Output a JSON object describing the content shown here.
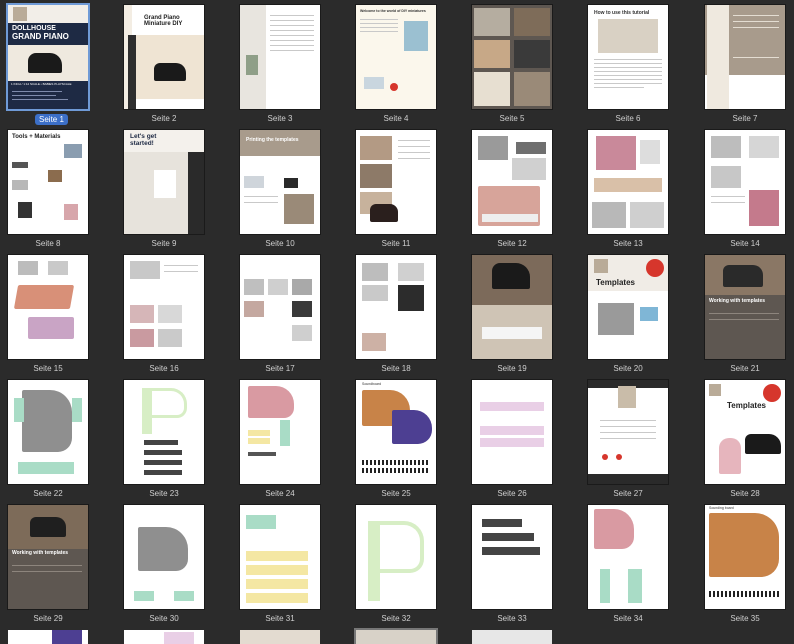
{
  "pages": [
    {
      "label": "Seite 1",
      "selected": true,
      "title_line1": "DOLLHOUSE",
      "title_line2": "GRAND PIANO",
      "subtitle": "1 INCH / 1:12 SCALE • BABIES PLAYSCALE"
    },
    {
      "label": "Seite 2",
      "title": "Grand Piano Miniature DIY"
    },
    {
      "label": "Seite 3"
    },
    {
      "label": "Seite 4",
      "title": "Welcome to the world of DIY miniatures"
    },
    {
      "label": "Seite 5"
    },
    {
      "label": "Seite 6",
      "title": "How to use this tutorial"
    },
    {
      "label": "Seite 7"
    },
    {
      "label": "Seite 8",
      "title": "Tools + Materials"
    },
    {
      "label": "Seite 9",
      "title": "Let's get started!"
    },
    {
      "label": "Seite 10",
      "title": "Printing the templates"
    },
    {
      "label": "Seite 11"
    },
    {
      "label": "Seite 12"
    },
    {
      "label": "Seite 13"
    },
    {
      "label": "Seite 14"
    },
    {
      "label": "Seite 15"
    },
    {
      "label": "Seite 16"
    },
    {
      "label": "Seite 17"
    },
    {
      "label": "Seite 18"
    },
    {
      "label": "Seite 19"
    },
    {
      "label": "Seite 20",
      "title": "Templates"
    },
    {
      "label": "Seite 21",
      "title": "Working with templates"
    },
    {
      "label": "Seite 22"
    },
    {
      "label": "Seite 23"
    },
    {
      "label": "Seite 24"
    },
    {
      "label": "Seite 25",
      "title": "Soundboard"
    },
    {
      "label": "Seite 26"
    },
    {
      "label": "Seite 27"
    },
    {
      "label": "Seite 28",
      "title": "Templates"
    },
    {
      "label": "Seite 29",
      "title": "Working with templates"
    },
    {
      "label": "Seite 30"
    },
    {
      "label": "Seite 31"
    },
    {
      "label": "Seite 32"
    },
    {
      "label": "Seite 33"
    },
    {
      "label": "Seite 34"
    },
    {
      "label": "Seite 35",
      "title": "Sounding board"
    }
  ],
  "colors": {
    "background": "#2b2b2b",
    "selection": "#3c6fc7",
    "navy": "#1e2a44",
    "taupe": "#a89b8c",
    "dark_taupe": "#5e5751",
    "pink": "#d99aa2",
    "mint": "#a9dcc6",
    "yellow": "#f4e7a3",
    "gray_shape": "#8f8f8f",
    "purple": "#4d3f92",
    "lilac": "#e9cfe6",
    "orange_wood": "#c88348",
    "red_badge": "#d6362c"
  }
}
